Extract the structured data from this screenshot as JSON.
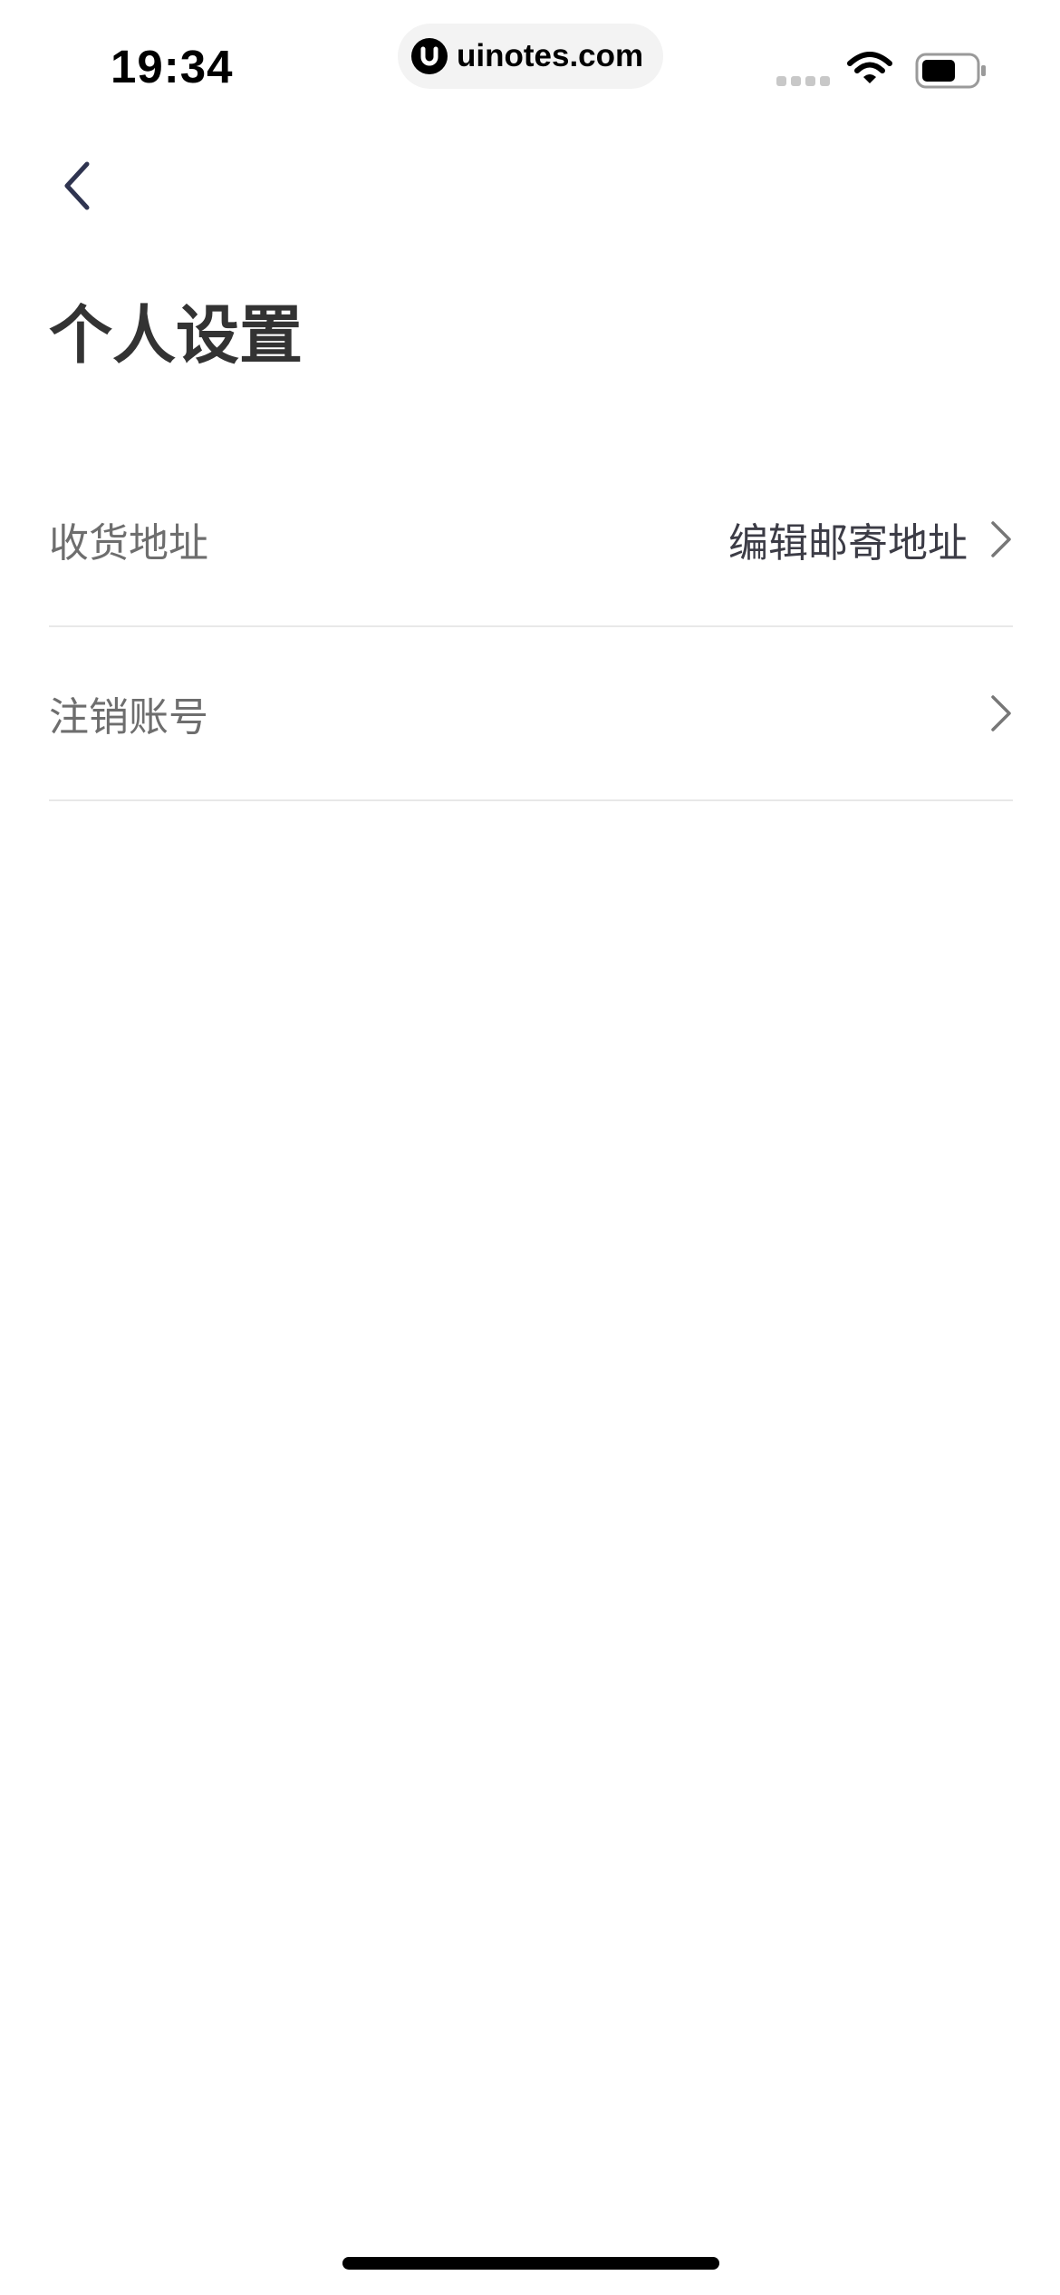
{
  "status_bar": {
    "time": "19:34",
    "url": "uinotes.com",
    "battery_level": 0.65
  },
  "header": {
    "back_icon": "chevron-left-icon",
    "title": "个人设置"
  },
  "settings": {
    "items": [
      {
        "label": "收货地址",
        "value": "编辑邮寄地址",
        "icon": "chevron-right-icon"
      },
      {
        "label": "注销账号",
        "value": "",
        "icon": "chevron-right-icon"
      }
    ]
  },
  "colors": {
    "title": "#333333",
    "label": "#6e6e6e",
    "value": "#3c3c46",
    "divider": "#e8e8e8",
    "back_arrow": "#2f3450"
  }
}
